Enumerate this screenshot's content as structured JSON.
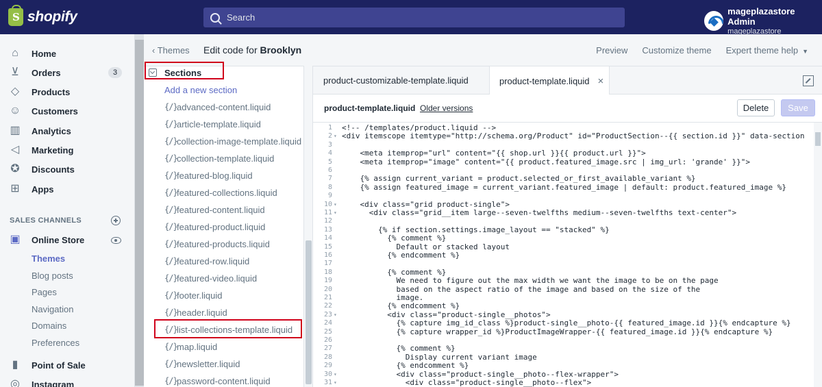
{
  "topbar": {
    "brand": "shopify",
    "search_placeholder": "Search",
    "account_name": "mageplazastore Admin",
    "account_store": "mageplazastore"
  },
  "nav": {
    "items": [
      {
        "label": "Home",
        "icon": "home-icon"
      },
      {
        "label": "Orders",
        "icon": "orders-icon",
        "badge": "3"
      },
      {
        "label": "Products",
        "icon": "tag-icon"
      },
      {
        "label": "Customers",
        "icon": "person-icon"
      },
      {
        "label": "Analytics",
        "icon": "bar-chart-icon"
      },
      {
        "label": "Marketing",
        "icon": "megaphone-icon"
      },
      {
        "label": "Discounts",
        "icon": "discount-icon"
      },
      {
        "label": "Apps",
        "icon": "apps-icon"
      }
    ],
    "sales_channels_label": "SALES CHANNELS",
    "online_store_label": "Online Store",
    "online_store_sub": [
      {
        "label": "Themes",
        "active": true
      },
      {
        "label": "Blog posts"
      },
      {
        "label": "Pages"
      },
      {
        "label": "Navigation"
      },
      {
        "label": "Domains"
      },
      {
        "label": "Preferences"
      }
    ],
    "point_of_sale_label": "Point of Sale",
    "instagram_label": "Instagram"
  },
  "editor_header": {
    "back_label": "Themes",
    "title_prefix": "Edit code for",
    "theme_name": "Brooklyn",
    "links": {
      "preview": "Preview",
      "customize": "Customize theme",
      "help": "Expert theme help"
    }
  },
  "filetree": {
    "folder": "Sections",
    "add_link": "Add a new section",
    "files": [
      "advanced-content.liquid",
      "article-template.liquid",
      "collection-image-template.liquid",
      "collection-template.liquid",
      "featured-blog.liquid",
      "featured-collections.liquid",
      "featured-content.liquid",
      "featured-product.liquid",
      "featured-products.liquid",
      "featured-row.liquid",
      "featured-video.liquid",
      "footer.liquid",
      "header.liquid",
      "list-collections-template.liquid",
      "map.liquid",
      "newsletter.liquid",
      "password-content.liquid"
    ],
    "file_icon_glyph": "{/}"
  },
  "tabs": {
    "tab1": "product-customizable-template.liquid",
    "tab2": "product-template.liquid",
    "close_glyph": "×"
  },
  "file_toolbar": {
    "file_name": "product-template.liquid",
    "older_versions": "Older versions",
    "delete_label": "Delete",
    "save_label": "Save"
  },
  "code": {
    "lines": [
      {
        "n": "1",
        "f": "",
        "t": "<!-- /templates/product.liquid -->"
      },
      {
        "n": "2",
        "f": "▾",
        "t": "<div itemscope itemtype=\"http://schema.org/Product\" id=\"ProductSection--{{ section.id }}\" data-section"
      },
      {
        "n": "3",
        "f": "",
        "t": ""
      },
      {
        "n": "4",
        "f": "",
        "t": "    <meta itemprop=\"url\" content=\"{{ shop.url }}{{ product.url }}\">"
      },
      {
        "n": "5",
        "f": "",
        "t": "    <meta itemprop=\"image\" content=\"{{ product.featured_image.src | img_url: 'grande' }}\">"
      },
      {
        "n": "6",
        "f": "",
        "t": ""
      },
      {
        "n": "7",
        "f": "",
        "t": "    {% assign current_variant = product.selected_or_first_available_variant %}"
      },
      {
        "n": "8",
        "f": "",
        "t": "    {% assign featured_image = current_variant.featured_image | default: product.featured_image %}"
      },
      {
        "n": "9",
        "f": "",
        "t": ""
      },
      {
        "n": "10",
        "f": "▾",
        "t": "    <div class=\"grid product-single\">"
      },
      {
        "n": "11",
        "f": "▾",
        "t": "      <div class=\"grid__item large--seven-twelfths medium--seven-twelfths text-center\">"
      },
      {
        "n": "12",
        "f": "",
        "t": ""
      },
      {
        "n": "13",
        "f": "",
        "t": "        {% if section.settings.image_layout == \"stacked\" %}"
      },
      {
        "n": "14",
        "f": "",
        "t": "          {% comment %}"
      },
      {
        "n": "15",
        "f": "",
        "t": "            Default or stacked layout"
      },
      {
        "n": "16",
        "f": "",
        "t": "          {% endcomment %}"
      },
      {
        "n": "17",
        "f": "",
        "t": ""
      },
      {
        "n": "18",
        "f": "",
        "t": "          {% comment %}"
      },
      {
        "n": "19",
        "f": "",
        "t": "            We need to figure out the max width we want the image to be on the page"
      },
      {
        "n": "20",
        "f": "",
        "t": "            based on the aspect ratio of the image and based on the size of the"
      },
      {
        "n": "21",
        "f": "",
        "t": "            image."
      },
      {
        "n": "22",
        "f": "",
        "t": "          {% endcomment %}"
      },
      {
        "n": "23",
        "f": "▾",
        "t": "          <div class=\"product-single__photos\">"
      },
      {
        "n": "24",
        "f": "",
        "t": "            {% capture img_id_class %}product-single__photo-{{ featured_image.id }}{% endcapture %}"
      },
      {
        "n": "25",
        "f": "",
        "t": "            {% capture wrapper_id %}ProductImageWrapper-{{ featured_image.id }}{% endcapture %}"
      },
      {
        "n": "26",
        "f": "",
        "t": ""
      },
      {
        "n": "27",
        "f": "",
        "t": "            {% comment %}"
      },
      {
        "n": "28",
        "f": "",
        "t": "              Display current variant image"
      },
      {
        "n": "29",
        "f": "",
        "t": "            {% endcomment %}"
      },
      {
        "n": "30",
        "f": "▾",
        "t": "            <div class=\"product-single__photo--flex-wrapper\">"
      },
      {
        "n": "31",
        "f": "▾",
        "t": "              <div class=\"product-single__photo--flex\">"
      }
    ]
  },
  "colors": {
    "topbar": "#1c2260",
    "accent": "#5c6ac4",
    "highlight": "#d0021b"
  }
}
